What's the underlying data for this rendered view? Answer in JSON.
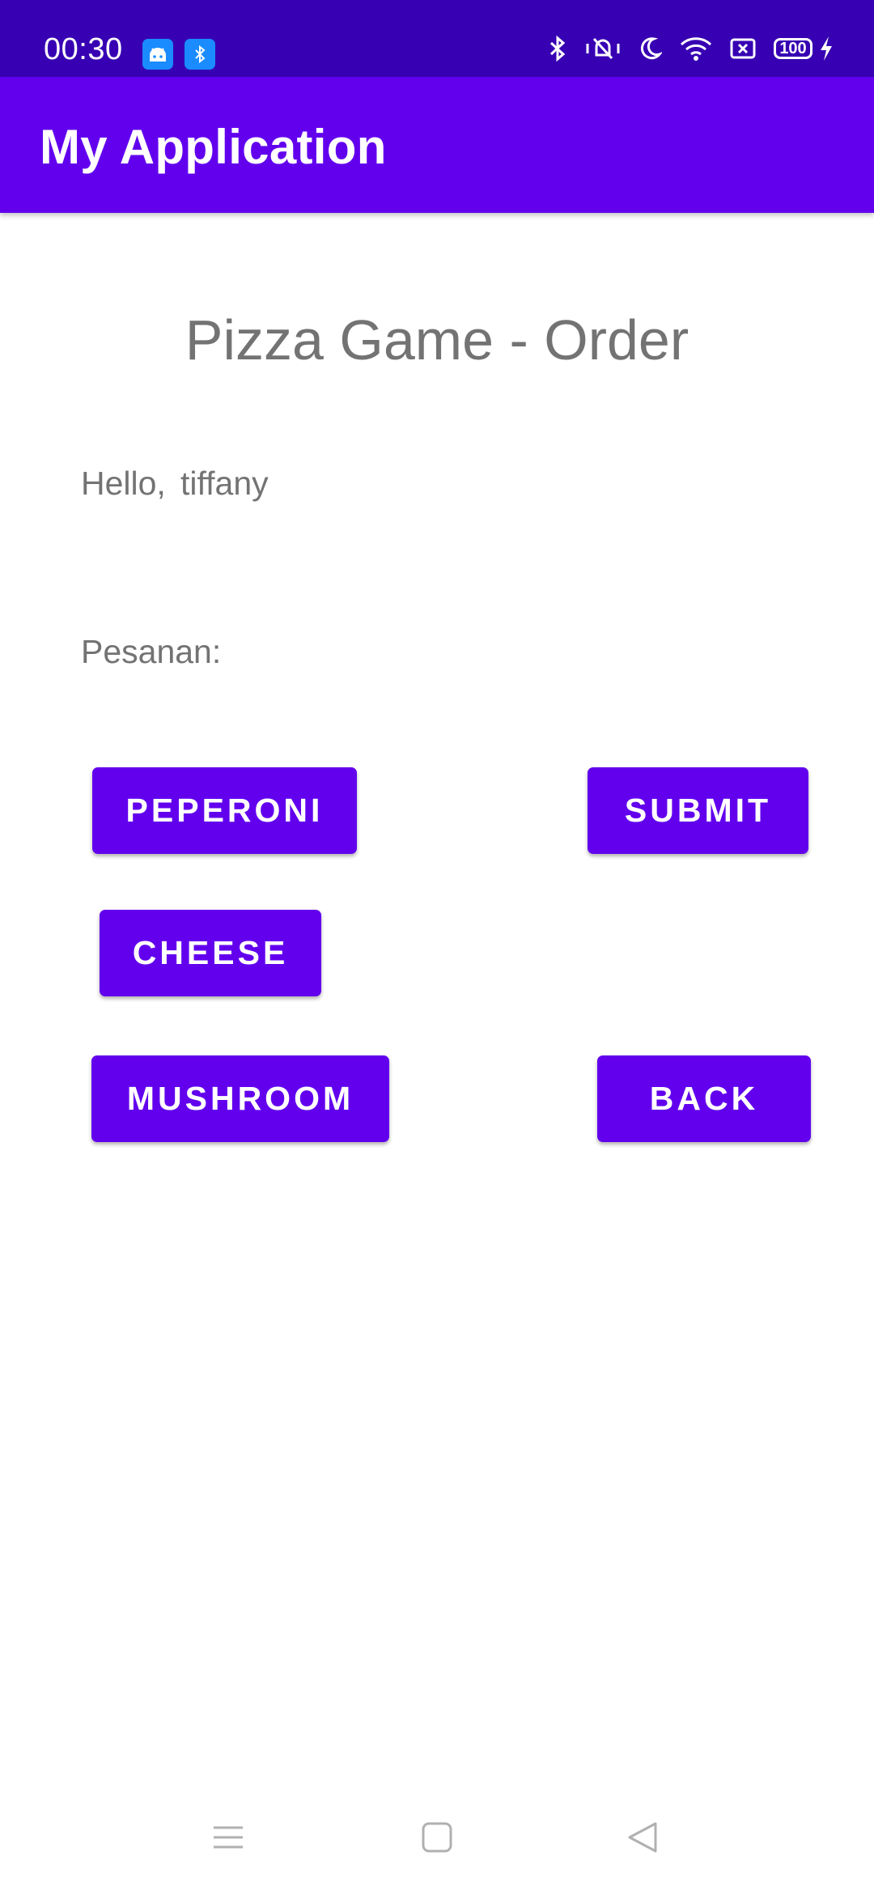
{
  "status_bar": {
    "time": "00:30",
    "battery": "100",
    "icons": [
      "android-notification-icon",
      "bluetooth-notification-icon",
      "bluetooth-icon",
      "vibrate-icon",
      "moon-icon",
      "wifi-icon",
      "screen-record-icon",
      "battery-icon",
      "charging-icon"
    ]
  },
  "app_bar": {
    "title": "My Application"
  },
  "main": {
    "title": "Pizza Game - Order",
    "greeting": "Hello,",
    "username": "tiffany",
    "order_label": "Pesanan:"
  },
  "buttons": {
    "peperoni": "PEPERONI",
    "submit": "SUBMIT",
    "cheese": "CHEESE",
    "mushroom": "MUSHROOM",
    "back": "BACK"
  },
  "nav_bar": {
    "icons": [
      "menu-icon",
      "home-icon",
      "back-icon"
    ]
  },
  "colors": {
    "primary": "#6200EE",
    "primary_dark": "#3700B3",
    "text": "#737373"
  }
}
